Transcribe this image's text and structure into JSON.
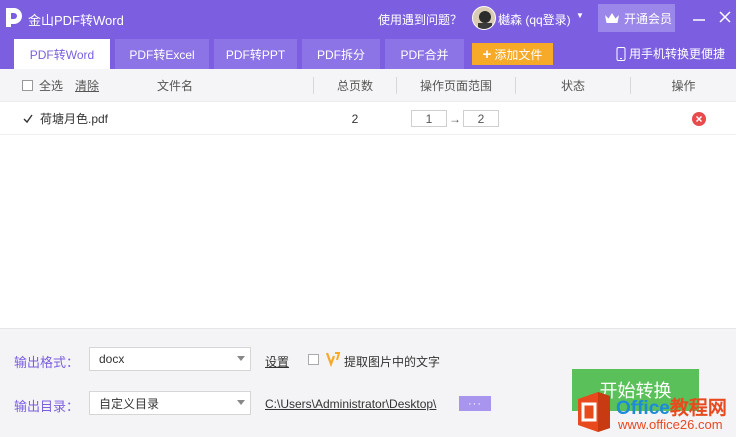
{
  "app": {
    "title": "金山PDF转Word",
    "help_text": "使用遇到问题？",
    "user_name": "樾森 (qq登录)",
    "vip_label": "开通会员",
    "icons": {
      "logo": "app-logo-icon",
      "vip": "crown-icon",
      "minimize": "minimize-icon",
      "close": "close-icon"
    }
  },
  "tabs": [
    {
      "label": "PDF转Word",
      "active": true
    },
    {
      "label": "PDF转Excel",
      "active": false
    },
    {
      "label": "PDF转PPT",
      "active": false
    },
    {
      "label": "PDF拆分",
      "active": false
    },
    {
      "label": "PDF合并",
      "active": false
    }
  ],
  "toolbar": {
    "add_file_label": "添加文件",
    "phone_link_label": "用手机转换更便捷"
  },
  "table": {
    "select_all_label": "全选",
    "clear_label": "清除",
    "columns": {
      "filename": "文件名",
      "pages": "总页数",
      "range": "操作页面范围",
      "status": "状态",
      "action": "操作"
    },
    "rows": [
      {
        "checked": true,
        "filename": "荷塘月色.pdf",
        "pages": "2",
        "range_from": "1",
        "range_arrow": "→",
        "range_to": "2",
        "status": ""
      }
    ]
  },
  "bottom": {
    "format_label": "输出格式：",
    "format_value": "docx",
    "settings_label": "设置",
    "ocr_label": "提取图片中的文字",
    "output_dir_label": "输出目录：",
    "output_dir_value": "自定义目录",
    "output_path": "C:\\Users\\Administrator\\Desktop\\",
    "browse_label": "···",
    "start_label": "开始转换"
  },
  "watermark": {
    "brand_en": "Office",
    "brand_cn": "教程网",
    "url": "www.office26.com"
  },
  "colors": {
    "primary": "#7b5fe0",
    "tab_inactive": "#8c74e6",
    "add_file": "#f7a928",
    "start": "#5ac15a",
    "delete": "#e84b4b"
  }
}
